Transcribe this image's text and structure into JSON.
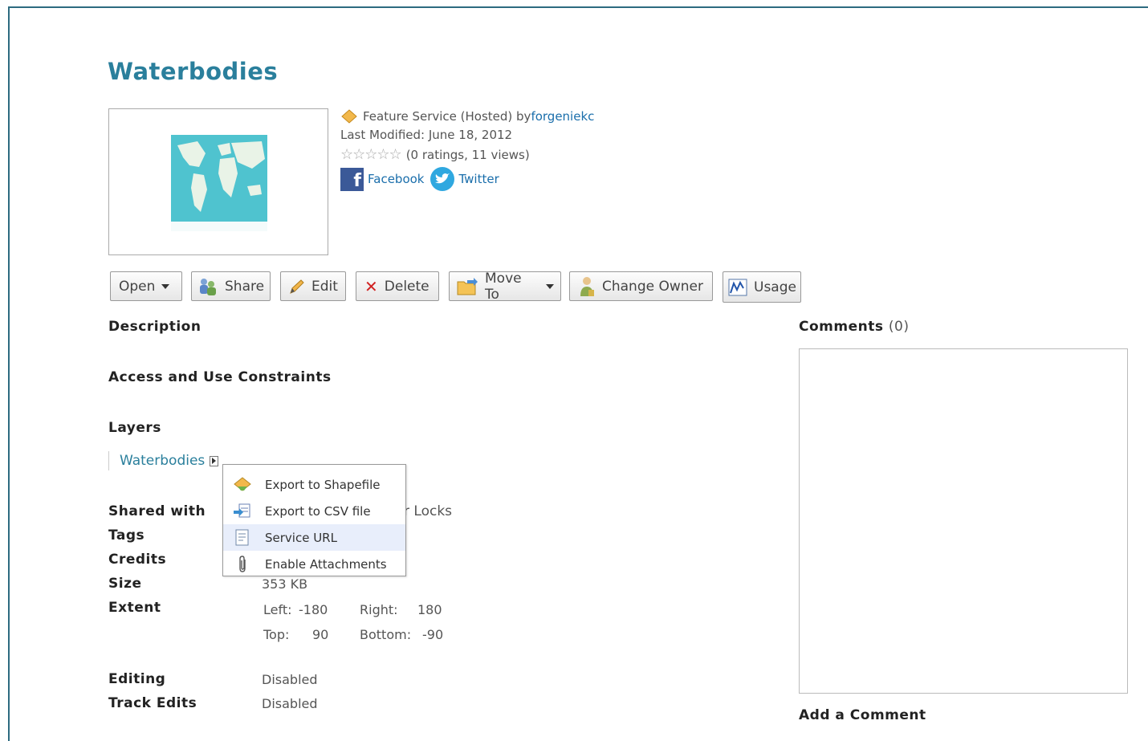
{
  "item": {
    "title": "Waterbodies",
    "type_prefix": "Feature Service (Hosted) by ",
    "owner": "forgeniekc",
    "last_modified": "Last Modified: June 18, 2012",
    "ratings": "(0 ratings, 11 views)",
    "facebook": "Facebook",
    "twitter": "Twitter"
  },
  "toolbar": {
    "open": "Open",
    "share": "Share",
    "edit": "Edit",
    "delete": "Delete",
    "move_to": "Move To",
    "change_owner": "Change Owner",
    "usage": "Usage"
  },
  "sections": {
    "description": "Description",
    "access": "Access and Use Constraints",
    "layers": "Layers",
    "layer_name": "Waterbodies",
    "shared_with": "Shared with",
    "shared_value_partial": "r Locks",
    "tags": "Tags",
    "credits": "Credits",
    "size": "Size",
    "size_value": "353 KB",
    "extent": "Extent",
    "left_label": "Left:",
    "left_value": "-180",
    "right_label": "Right:",
    "right_value": "180",
    "top_label": "Top:",
    "top_value": "90",
    "bottom_label": "Bottom:",
    "bottom_value": "-90",
    "editing": "Editing",
    "editing_value": "Disabled",
    "track_edits": "Track Edits",
    "track_edits_value": "Disabled"
  },
  "context_menu": {
    "items": [
      {
        "label": "Export to Shapefile",
        "icon": "shapefile-icon"
      },
      {
        "label": "Export to CSV file",
        "icon": "csv-icon"
      },
      {
        "label": "Service URL",
        "icon": "document-icon",
        "highlighted": true
      },
      {
        "label": "Enable Attachments",
        "icon": "paperclip-icon"
      }
    ]
  },
  "comments": {
    "heading": "Comments",
    "count": "(0)",
    "add": "Add a Comment"
  },
  "colors": {
    "title": "#2a7f9c",
    "link": "#1a6eab",
    "menu_highlight": "#e8eefb"
  }
}
